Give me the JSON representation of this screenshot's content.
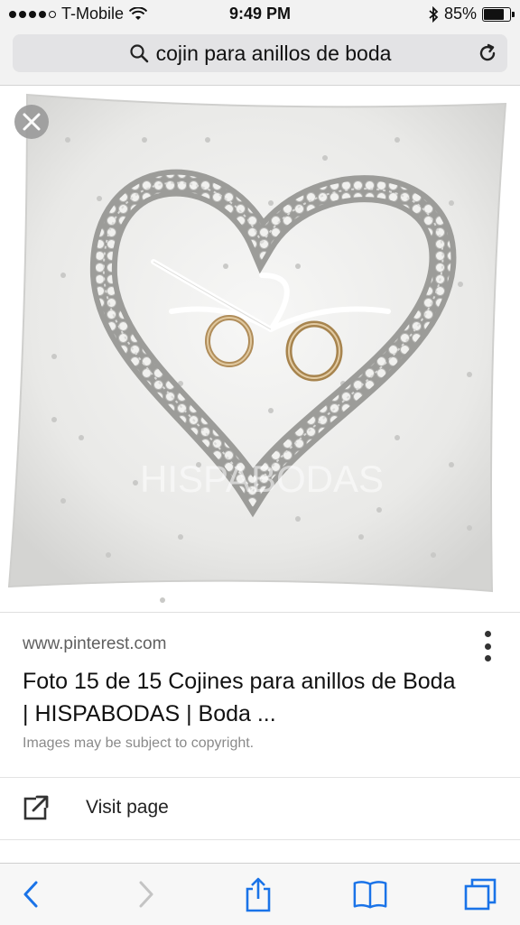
{
  "status_bar": {
    "carrier": "T-Mobile",
    "time": "9:49 PM",
    "battery_percent_label": "85%",
    "battery_level": 0.85,
    "signal_bars_filled": 4,
    "signal_bars_total": 5
  },
  "address_bar": {
    "query": "cojin para anillos de boda",
    "search_icon": "search-icon",
    "reload_icon": "reload-icon"
  },
  "image": {
    "watermark": "HISPABODAS",
    "close_icon": "close-icon"
  },
  "result": {
    "source_url": "www.pinterest.com",
    "title": "Foto 15 de 15 Cojines para anillos de Boda | HISPABODAS | Boda ...",
    "copyright_note": "Images may be subject to copyright.",
    "more_icon": "more-vertical-icon"
  },
  "visit": {
    "label": "Visit page",
    "icon": "external-link-icon"
  },
  "bottom_toolbar": {
    "items": [
      "back-icon",
      "forward-icon",
      "share-icon",
      "bookmarks-icon",
      "tabs-icon"
    ],
    "accent_color": "#1a73e8"
  }
}
